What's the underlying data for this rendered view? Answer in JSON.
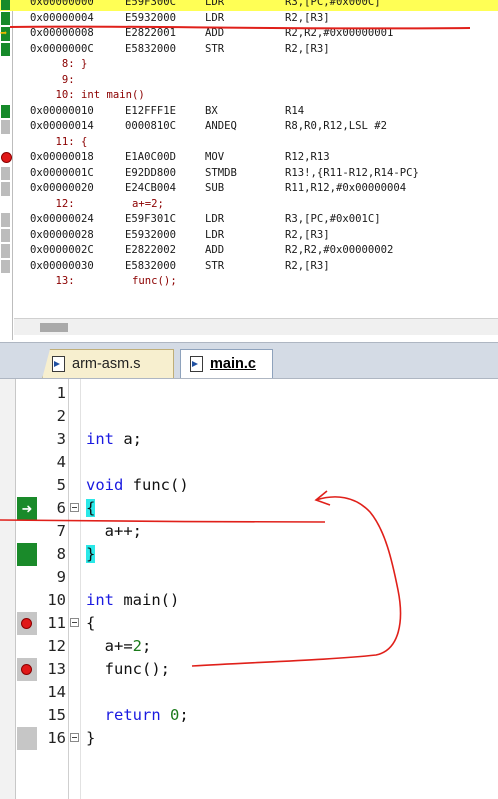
{
  "disassembly": {
    "rows": [
      {
        "kind": "asm",
        "addr": "0x00000000",
        "opcode": "E59F300C",
        "mnemonic": "LDR",
        "args": "R3,[PC,#0x000C]",
        "marker": "green",
        "highlight": true
      },
      {
        "kind": "asm",
        "addr": "0x00000004",
        "opcode": "E5932000",
        "mnemonic": "LDR",
        "args": "R2,[R3]",
        "marker": "green"
      },
      {
        "kind": "asm",
        "addr": "0x00000008",
        "opcode": "E2822001",
        "mnemonic": "ADD",
        "args": "R2,R2,#0x00000001",
        "marker": "arrow"
      },
      {
        "kind": "asm",
        "addr": "0x0000000C",
        "opcode": "E5832000",
        "mnemonic": "STR",
        "args": "R2,[R3]",
        "marker": "green"
      },
      {
        "kind": "src",
        "text": "     8: }"
      },
      {
        "kind": "src",
        "text": "     9: "
      },
      {
        "kind": "src",
        "text": "    10: int main()"
      },
      {
        "kind": "asm",
        "addr": "0x00000010",
        "opcode": "E12FFF1E",
        "mnemonic": "BX",
        "args": "R14",
        "marker": "green"
      },
      {
        "kind": "asm",
        "addr": "0x00000014",
        "opcode": "0000810C",
        "mnemonic": "ANDEQ",
        "args": "R8,R0,R12,LSL #2",
        "marker": "grey"
      },
      {
        "kind": "src",
        "text": "    11: {"
      },
      {
        "kind": "asm",
        "addr": "0x00000018",
        "opcode": "E1A0C00D",
        "mnemonic": "MOV",
        "args": "R12,R13",
        "marker": "breakpoint"
      },
      {
        "kind": "asm",
        "addr": "0x0000001C",
        "opcode": "E92DD800",
        "mnemonic": "STMDB",
        "args": "R13!,{R11-R12,R14-PC}",
        "marker": "grey"
      },
      {
        "kind": "asm",
        "addr": "0x00000020",
        "opcode": "E24CB004",
        "mnemonic": "SUB",
        "args": "R11,R12,#0x00000004",
        "marker": "grey"
      },
      {
        "kind": "src",
        "text": "    12:         a+=2;"
      },
      {
        "kind": "asm",
        "addr": "0x00000024",
        "opcode": "E59F301C",
        "mnemonic": "LDR",
        "args": "R3,[PC,#0x001C]",
        "marker": "grey"
      },
      {
        "kind": "asm",
        "addr": "0x00000028",
        "opcode": "E5932000",
        "mnemonic": "LDR",
        "args": "R2,[R3]",
        "marker": "grey"
      },
      {
        "kind": "asm",
        "addr": "0x0000002C",
        "opcode": "E2822002",
        "mnemonic": "ADD",
        "args": "R2,R2,#0x00000002",
        "marker": "grey"
      },
      {
        "kind": "asm",
        "addr": "0x00000030",
        "opcode": "E5832000",
        "mnemonic": "STR",
        "args": "R2,[R3]",
        "marker": "grey"
      },
      {
        "kind": "src",
        "text": "    13:         func();"
      }
    ]
  },
  "tabs": [
    {
      "label": "arm-asm.s",
      "active": false
    },
    {
      "label": "main.c",
      "active": true
    }
  ],
  "editor": {
    "lines": [
      {
        "n": "1",
        "code": ""
      },
      {
        "n": "2",
        "code": ""
      },
      {
        "n": "3",
        "code": "int a;"
      },
      {
        "n": "4",
        "code": ""
      },
      {
        "n": "5",
        "code": "void func()"
      },
      {
        "n": "6",
        "code": "{",
        "marker": "arrow",
        "fold": true,
        "brace_hl": true
      },
      {
        "n": "7",
        "code": "  a++;"
      },
      {
        "n": "8",
        "code": "}",
        "marker": "green",
        "brace_hl": true
      },
      {
        "n": "9",
        "code": ""
      },
      {
        "n": "10",
        "code": "int main()"
      },
      {
        "n": "11",
        "code": "{",
        "marker": "breakpoint",
        "fold": true
      },
      {
        "n": "12",
        "code": "  a+=2;"
      },
      {
        "n": "13",
        "code": "  func();",
        "marker": "breakpoint"
      },
      {
        "n": "14",
        "code": ""
      },
      {
        "n": "15",
        "code": "  return 0;"
      },
      {
        "n": "16",
        "code": "}",
        "marker": "grey",
        "fold": true
      }
    ]
  },
  "colors": {
    "exec_highlight": "#ffff55",
    "executed_marker": "#1a8a2a",
    "breakpoint": "#e01818",
    "keyword": "#1a1ae0",
    "annotation": "#e0201a"
  },
  "icons": [
    "file-asm-icon",
    "file-c-icon",
    "breakpoint-icon",
    "current-line-arrow-icon",
    "fold-icon"
  ]
}
